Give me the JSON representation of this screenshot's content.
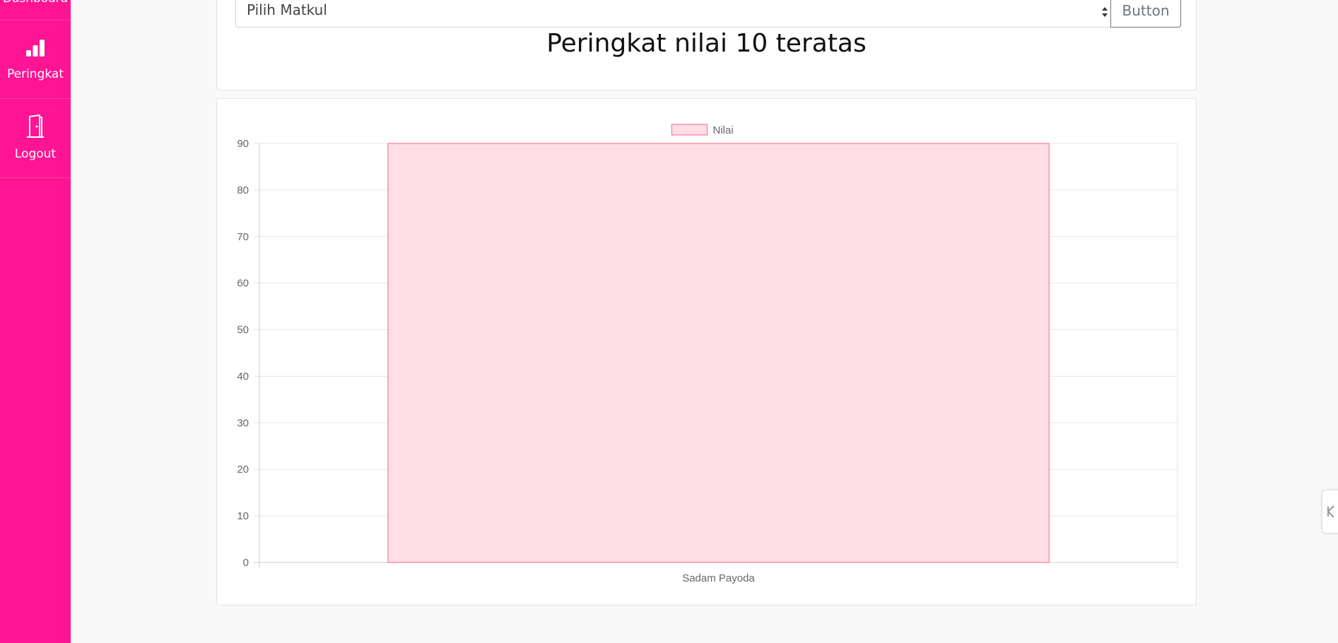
{
  "sidebar": {
    "items": [
      {
        "label": "Dashboard",
        "icon": "dashboard-icon"
      },
      {
        "label": "Peringkat",
        "icon": "bar-chart-icon"
      },
      {
        "label": "Logout",
        "icon": "door-icon"
      }
    ]
  },
  "filter": {
    "select_value": "Pilih Matkul",
    "button_label": "Button"
  },
  "page_title": "Peringkat nilai 10 teratas",
  "colors": {
    "sidebar": "#ff1493",
    "bar_fill": "#ffdfe5",
    "bar_border": "#ff6384"
  },
  "chart_data": {
    "type": "bar",
    "categories": [
      "Sadam Payoda"
    ],
    "series": [
      {
        "name": "Nilai",
        "values": [
          90
        ]
      }
    ],
    "ylim": [
      0,
      90
    ],
    "yticks": [
      0,
      10,
      20,
      30,
      40,
      50,
      60,
      70,
      80,
      90
    ],
    "grid": true,
    "legend": "top-center"
  }
}
